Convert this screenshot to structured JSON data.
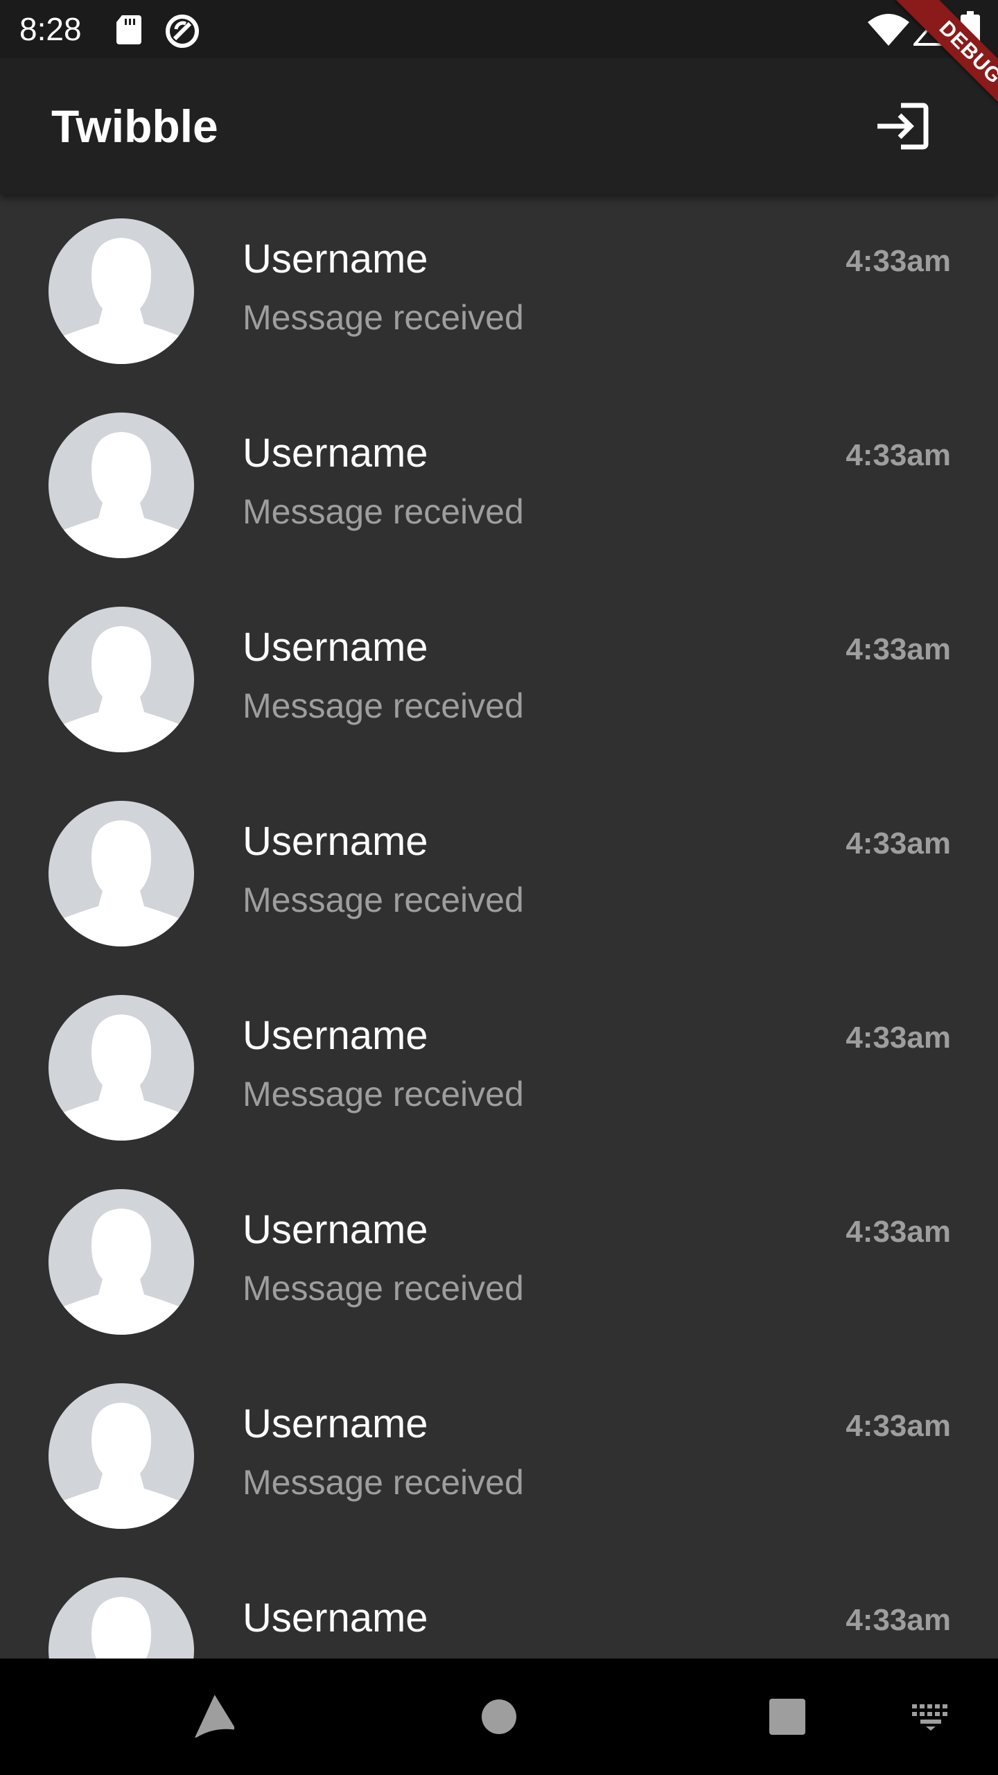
{
  "status_bar": {
    "time": "8:28",
    "icons": [
      "sd-card-icon",
      "sync-icon",
      "wifi-icon",
      "cell-signal-icon",
      "battery-icon"
    ]
  },
  "app_bar": {
    "title": "Twibble",
    "action_icon": "login-icon"
  },
  "debug_banner": "DEBUG",
  "messages": [
    {
      "username": "Username",
      "preview": "Message received",
      "time": "4:33am"
    },
    {
      "username": "Username",
      "preview": "Message received",
      "time": "4:33am"
    },
    {
      "username": "Username",
      "preview": "Message received",
      "time": "4:33am"
    },
    {
      "username": "Username",
      "preview": "Message received",
      "time": "4:33am"
    },
    {
      "username": "Username",
      "preview": "Message received",
      "time": "4:33am"
    },
    {
      "username": "Username",
      "preview": "Message received",
      "time": "4:33am"
    },
    {
      "username": "Username",
      "preview": "Message received",
      "time": "4:33am"
    },
    {
      "username": "Username",
      "preview": "",
      "time": "4:33am"
    }
  ],
  "nav_bar": {
    "icons": [
      "back-icon",
      "home-icon",
      "recents-icon",
      "keyboard-icon"
    ]
  },
  "colors": {
    "background": "#303030",
    "app_bar": "#212121",
    "status_bar": "#1b1b1b",
    "avatar_bg": "#d1d4d9",
    "secondary_text": "#9e9e9e",
    "debug_banner": "#8b1a1a"
  }
}
